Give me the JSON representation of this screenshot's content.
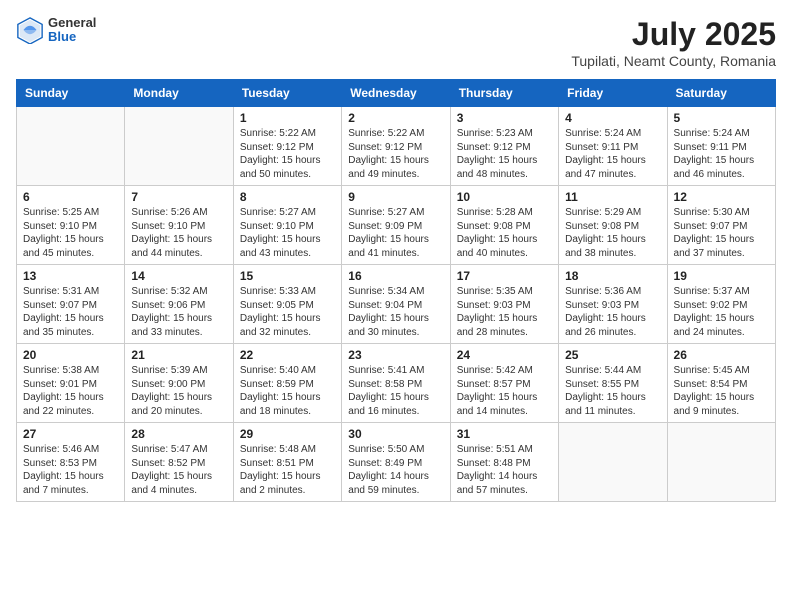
{
  "header": {
    "logo_general": "General",
    "logo_blue": "Blue",
    "month_year": "July 2025",
    "location": "Tupilati, Neamt County, Romania"
  },
  "weekdays": [
    "Sunday",
    "Monday",
    "Tuesday",
    "Wednesday",
    "Thursday",
    "Friday",
    "Saturday"
  ],
  "weeks": [
    [
      {
        "day": "",
        "info": ""
      },
      {
        "day": "",
        "info": ""
      },
      {
        "day": "1",
        "info": "Sunrise: 5:22 AM\nSunset: 9:12 PM\nDaylight: 15 hours\nand 50 minutes."
      },
      {
        "day": "2",
        "info": "Sunrise: 5:22 AM\nSunset: 9:12 PM\nDaylight: 15 hours\nand 49 minutes."
      },
      {
        "day": "3",
        "info": "Sunrise: 5:23 AM\nSunset: 9:12 PM\nDaylight: 15 hours\nand 48 minutes."
      },
      {
        "day": "4",
        "info": "Sunrise: 5:24 AM\nSunset: 9:11 PM\nDaylight: 15 hours\nand 47 minutes."
      },
      {
        "day": "5",
        "info": "Sunrise: 5:24 AM\nSunset: 9:11 PM\nDaylight: 15 hours\nand 46 minutes."
      }
    ],
    [
      {
        "day": "6",
        "info": "Sunrise: 5:25 AM\nSunset: 9:10 PM\nDaylight: 15 hours\nand 45 minutes."
      },
      {
        "day": "7",
        "info": "Sunrise: 5:26 AM\nSunset: 9:10 PM\nDaylight: 15 hours\nand 44 minutes."
      },
      {
        "day": "8",
        "info": "Sunrise: 5:27 AM\nSunset: 9:10 PM\nDaylight: 15 hours\nand 43 minutes."
      },
      {
        "day": "9",
        "info": "Sunrise: 5:27 AM\nSunset: 9:09 PM\nDaylight: 15 hours\nand 41 minutes."
      },
      {
        "day": "10",
        "info": "Sunrise: 5:28 AM\nSunset: 9:08 PM\nDaylight: 15 hours\nand 40 minutes."
      },
      {
        "day": "11",
        "info": "Sunrise: 5:29 AM\nSunset: 9:08 PM\nDaylight: 15 hours\nand 38 minutes."
      },
      {
        "day": "12",
        "info": "Sunrise: 5:30 AM\nSunset: 9:07 PM\nDaylight: 15 hours\nand 37 minutes."
      }
    ],
    [
      {
        "day": "13",
        "info": "Sunrise: 5:31 AM\nSunset: 9:07 PM\nDaylight: 15 hours\nand 35 minutes."
      },
      {
        "day": "14",
        "info": "Sunrise: 5:32 AM\nSunset: 9:06 PM\nDaylight: 15 hours\nand 33 minutes."
      },
      {
        "day": "15",
        "info": "Sunrise: 5:33 AM\nSunset: 9:05 PM\nDaylight: 15 hours\nand 32 minutes."
      },
      {
        "day": "16",
        "info": "Sunrise: 5:34 AM\nSunset: 9:04 PM\nDaylight: 15 hours\nand 30 minutes."
      },
      {
        "day": "17",
        "info": "Sunrise: 5:35 AM\nSunset: 9:03 PM\nDaylight: 15 hours\nand 28 minutes."
      },
      {
        "day": "18",
        "info": "Sunrise: 5:36 AM\nSunset: 9:03 PM\nDaylight: 15 hours\nand 26 minutes."
      },
      {
        "day": "19",
        "info": "Sunrise: 5:37 AM\nSunset: 9:02 PM\nDaylight: 15 hours\nand 24 minutes."
      }
    ],
    [
      {
        "day": "20",
        "info": "Sunrise: 5:38 AM\nSunset: 9:01 PM\nDaylight: 15 hours\nand 22 minutes."
      },
      {
        "day": "21",
        "info": "Sunrise: 5:39 AM\nSunset: 9:00 PM\nDaylight: 15 hours\nand 20 minutes."
      },
      {
        "day": "22",
        "info": "Sunrise: 5:40 AM\nSunset: 8:59 PM\nDaylight: 15 hours\nand 18 minutes."
      },
      {
        "day": "23",
        "info": "Sunrise: 5:41 AM\nSunset: 8:58 PM\nDaylight: 15 hours\nand 16 minutes."
      },
      {
        "day": "24",
        "info": "Sunrise: 5:42 AM\nSunset: 8:57 PM\nDaylight: 15 hours\nand 14 minutes."
      },
      {
        "day": "25",
        "info": "Sunrise: 5:44 AM\nSunset: 8:55 PM\nDaylight: 15 hours\nand 11 minutes."
      },
      {
        "day": "26",
        "info": "Sunrise: 5:45 AM\nSunset: 8:54 PM\nDaylight: 15 hours\nand 9 minutes."
      }
    ],
    [
      {
        "day": "27",
        "info": "Sunrise: 5:46 AM\nSunset: 8:53 PM\nDaylight: 15 hours\nand 7 minutes."
      },
      {
        "day": "28",
        "info": "Sunrise: 5:47 AM\nSunset: 8:52 PM\nDaylight: 15 hours\nand 4 minutes."
      },
      {
        "day": "29",
        "info": "Sunrise: 5:48 AM\nSunset: 8:51 PM\nDaylight: 15 hours\nand 2 minutes."
      },
      {
        "day": "30",
        "info": "Sunrise: 5:50 AM\nSunset: 8:49 PM\nDaylight: 14 hours\nand 59 minutes."
      },
      {
        "day": "31",
        "info": "Sunrise: 5:51 AM\nSunset: 8:48 PM\nDaylight: 14 hours\nand 57 minutes."
      },
      {
        "day": "",
        "info": ""
      },
      {
        "day": "",
        "info": ""
      }
    ]
  ]
}
